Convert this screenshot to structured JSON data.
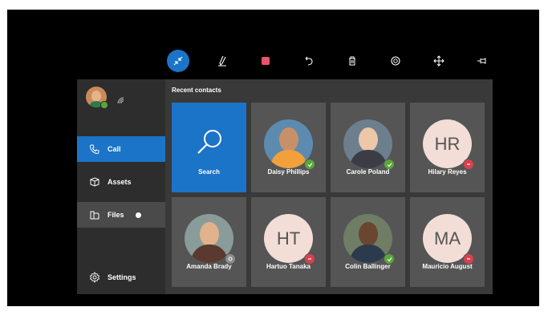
{
  "toolbar": {
    "buttons": [
      {
        "name": "collapse-icon",
        "active": true
      },
      {
        "name": "pen-icon",
        "active": false
      },
      {
        "name": "color-swatch-icon",
        "active": false,
        "color": "#e8546c"
      },
      {
        "name": "undo-icon",
        "active": false
      },
      {
        "name": "delete-icon",
        "active": false
      },
      {
        "name": "camera-icon",
        "active": false
      },
      {
        "name": "move-icon",
        "active": false
      },
      {
        "name": "pin-icon",
        "active": false
      }
    ],
    "accent": "#1b74c8"
  },
  "sidebar": {
    "nav": {
      "call": "Call",
      "assets": "Assets",
      "files": "Files",
      "settings": "Settings"
    },
    "selected": "Call",
    "user_status_color": "#5aa63a"
  },
  "main": {
    "title": "Recent contacts",
    "tiles": [
      {
        "label": "Search",
        "type": "search"
      },
      {
        "label": "Daisy Phillips",
        "type": "photo",
        "status": "green"
      },
      {
        "label": "Carole Poland",
        "type": "photo",
        "status": "green"
      },
      {
        "label": "Hilary Reyes",
        "type": "initials",
        "initials": "HR",
        "status": "red"
      },
      {
        "label": "Amanda Brady",
        "type": "photo",
        "status": "grey"
      },
      {
        "label": "Hartuo Tanaka",
        "type": "initials",
        "initials": "HT",
        "status": "red"
      },
      {
        "label": "Colin Ballinger",
        "type": "photo",
        "status": "green"
      },
      {
        "label": "Mauricio August",
        "type": "initials",
        "initials": "MA",
        "status": "red"
      }
    ]
  },
  "colors": {
    "available": "#5aa63a",
    "busy": "#d7424e",
    "offline": "#8a8a8a"
  }
}
